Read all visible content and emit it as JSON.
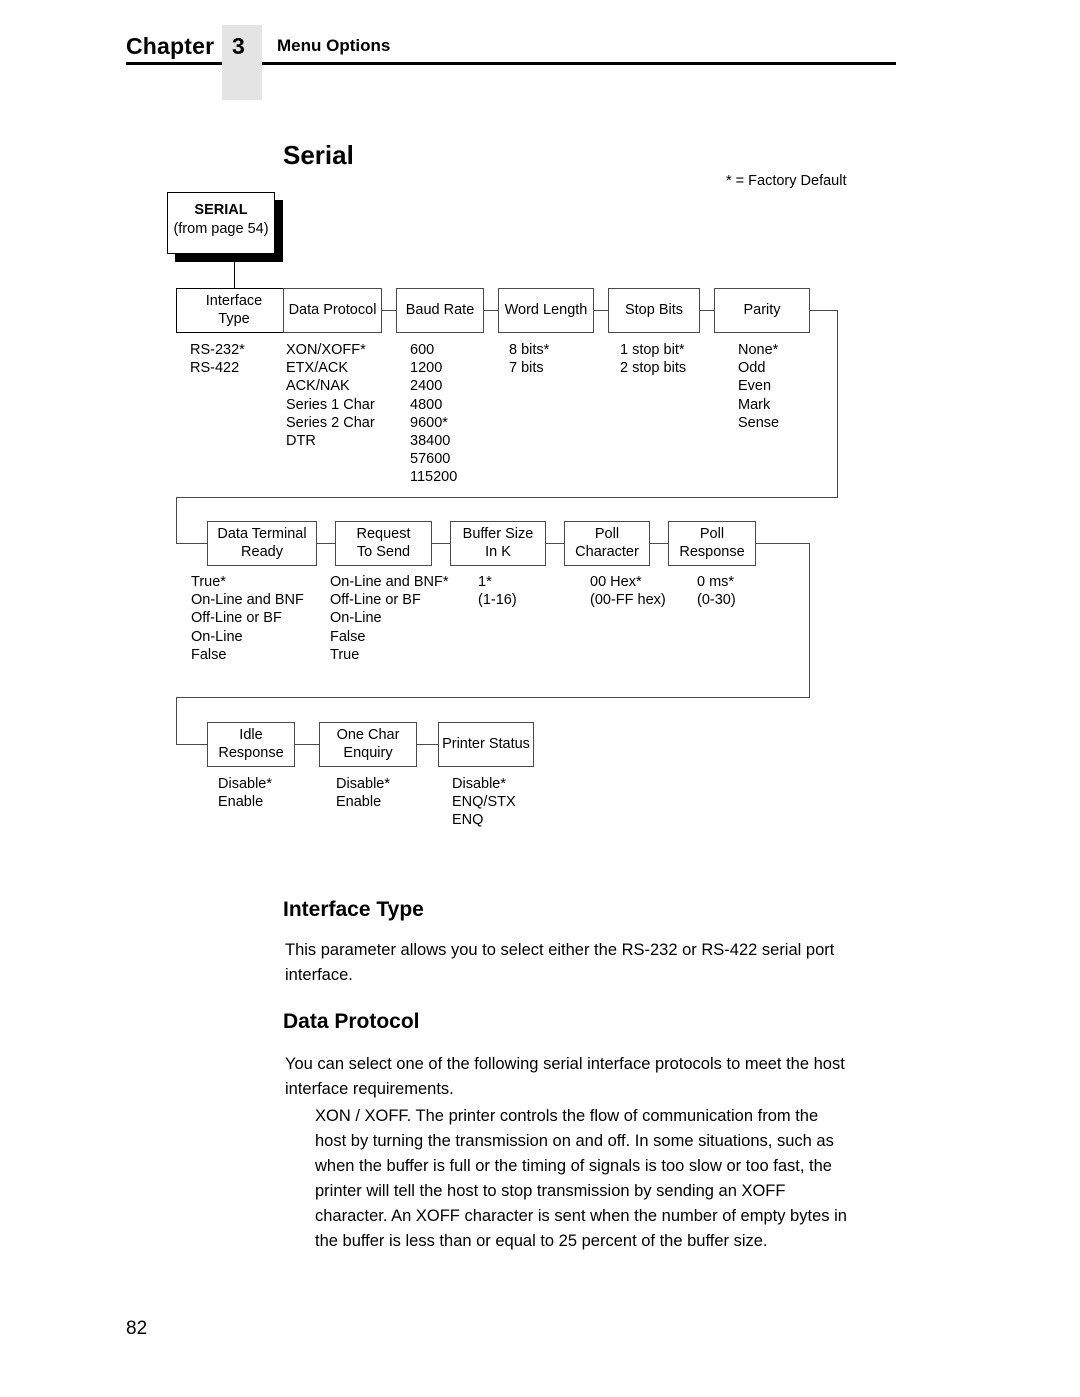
{
  "header": {
    "chapter_word": "Chapter",
    "chapter_number": "3",
    "title": "Menu Options"
  },
  "page_title": "Serial",
  "factory_default_note": "* = Factory Default",
  "root_node": {
    "title": "SERIAL",
    "subtitle": "(from page 54)"
  },
  "flowchart": {
    "rows": [
      {
        "nodes": [
          {
            "label": "Interface\nType",
            "options": "RS-232*\nRS-422"
          },
          {
            "label": "Data Protocol",
            "options": "XON/XOFF*\nETX/ACK\nACK/NAK\nSeries 1 Char\nSeries 2 Char\nDTR"
          },
          {
            "label": "Baud Rate",
            "options": "600\n1200\n2400\n4800\n9600*\n38400\n57600\n115200"
          },
          {
            "label": "Word Length",
            "options": "8 bits*\n7 bits"
          },
          {
            "label": "Stop Bits",
            "options": "1 stop bit*\n2 stop bits"
          },
          {
            "label": "Parity",
            "options": "None*\nOdd\nEven\nMark\nSense"
          }
        ]
      },
      {
        "nodes": [
          {
            "label": "Data Terminal\nReady",
            "options": "True*\nOn-Line and BNF\nOff-Line or BF\nOn-Line\nFalse"
          },
          {
            "label": "Request\nTo Send",
            "options": "On-Line and BNF*\nOff-Line or BF\nOn-Line\nFalse\nTrue"
          },
          {
            "label": "Buffer Size\nIn K",
            "options": "1*\n(1-16)"
          },
          {
            "label": "Poll\nCharacter",
            "options": "00 Hex*\n(00-FF hex)"
          },
          {
            "label": "Poll\nResponse",
            "options": "0 ms*\n(0-30)"
          }
        ]
      },
      {
        "nodes": [
          {
            "label": "Idle\nResponse",
            "options": "Disable*\nEnable"
          },
          {
            "label": "One Char\nEnquiry",
            "options": "Disable*\nEnable"
          },
          {
            "label": "Printer Status",
            "options": "Disable*\nENQ/STX\nENQ"
          }
        ]
      }
    ]
  },
  "sections": [
    {
      "heading": "Interface Type",
      "body": "This parameter allows you to select either the RS-232 or RS-422 serial port\ninterface."
    },
    {
      "heading": "Data Protocol",
      "body": "You can select one of the following serial interface protocols to meet the host\ninterface requirements."
    }
  ],
  "xon_xoff_paragraph": "XON / XOFF. The printer controls the flow of communication from the\nhost by turning the transmission on and off. In some situations, such as\nwhen the buffer is full or the timing of signals is too slow or too fast, the\nprinter will tell the host to stop transmission by sending an XOFF\ncharacter. An XOFF character is sent when the number of empty bytes in\nthe buffer is less than or equal to 25 percent of the buffer size.",
  "page_number": "82"
}
